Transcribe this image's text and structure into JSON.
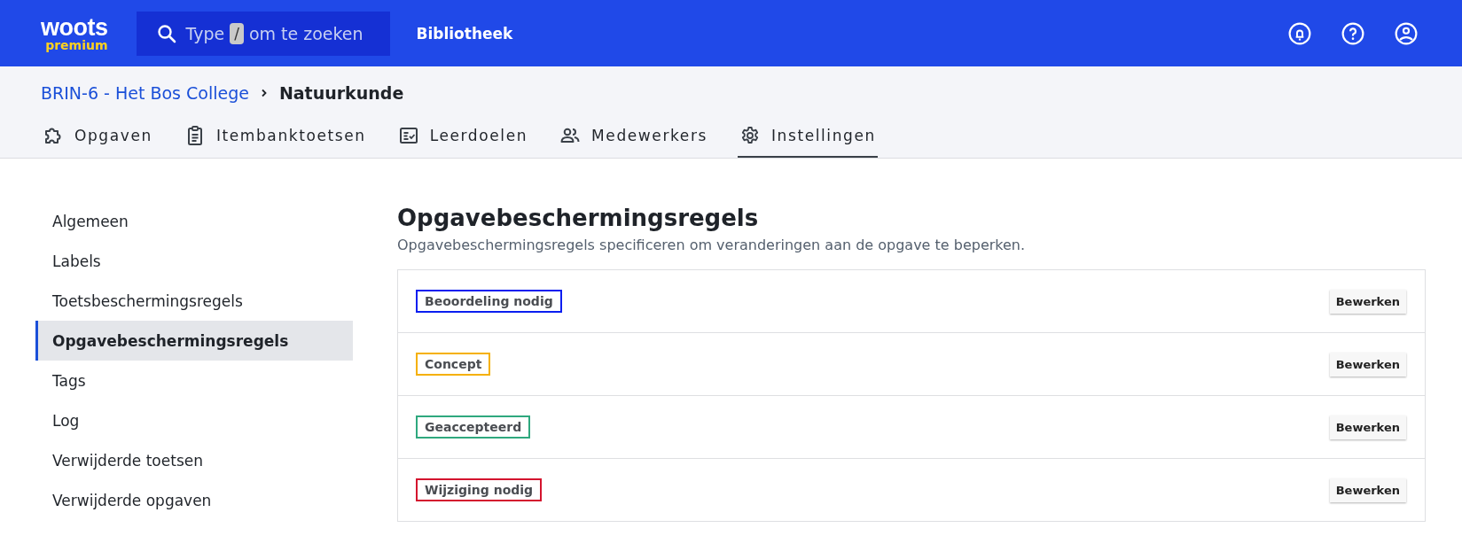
{
  "header": {
    "logo": {
      "name": "woots",
      "tier": "premium"
    },
    "search": {
      "hint_start": "Type",
      "key": "/",
      "hint_end": "om te zoeken"
    },
    "nav_link": "Bibliotheek"
  },
  "breadcrumb": [
    {
      "label": "BRIN-6 - Het Bos College",
      "kind": "link"
    },
    {
      "label": "Natuurkunde",
      "kind": "current"
    }
  ],
  "tabs": [
    {
      "label": "Opgaven",
      "kind": "puzzle",
      "selected": false
    },
    {
      "label": "Itembanktoetsen",
      "kind": "clipboard",
      "selected": false
    },
    {
      "label": "Leerdoelen",
      "kind": "checklist",
      "selected": false
    },
    {
      "label": "Medewerkers",
      "kind": "people",
      "selected": false
    },
    {
      "label": "Instellingen",
      "kind": "gear",
      "selected": true
    }
  ],
  "sidebar": {
    "items": [
      {
        "label": "Algemeen",
        "selected": false
      },
      {
        "label": "Labels",
        "selected": false
      },
      {
        "label": "Toetsbeschermingsregels",
        "selected": false
      },
      {
        "label": "Opgavebeschermingsregels",
        "selected": true
      },
      {
        "label": "Tags",
        "selected": false
      },
      {
        "label": "Log",
        "selected": false
      },
      {
        "label": "Verwijderde toetsen",
        "selected": false
      },
      {
        "label": "Verwijderde opgaven",
        "selected": false
      }
    ]
  },
  "content": {
    "title": "Opgavebeschermingsregels",
    "description": "Opgavebeschermingsregels specificeren om veranderingen aan de opgave te beperken.",
    "rules": [
      {
        "label": "Beoordeling nodig",
        "color": "#0a1ef0",
        "button": "Bewerken"
      },
      {
        "label": "Concept",
        "color": "#f5b000",
        "button": "Bewerken"
      },
      {
        "label": "Geaccepteerd",
        "color": "#2fa87e",
        "button": "Bewerken"
      },
      {
        "label": "Wijziging nodig",
        "color": "#d4142e",
        "button": "Bewerken"
      }
    ]
  }
}
